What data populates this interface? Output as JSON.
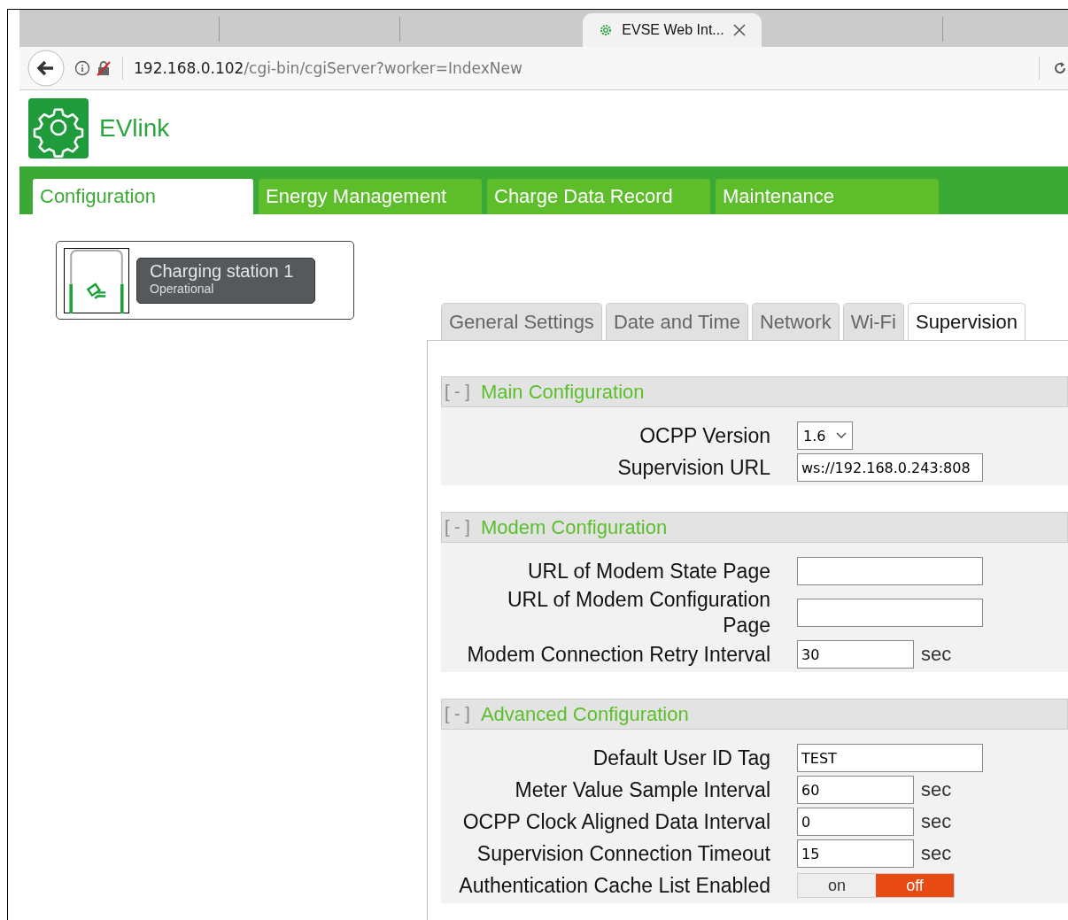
{
  "browser": {
    "tabs": [
      {
        "label": "EVSE Web Int...",
        "selected": true
      }
    ],
    "url_host": "192.168.0.102",
    "url_path": "/cgi-bin/cgiServer?worker=IndexNew"
  },
  "app": {
    "name": "EVlink"
  },
  "nav_tabs": [
    {
      "label": "Configuration",
      "selected": true
    },
    {
      "label": "Energy Management",
      "selected": false
    },
    {
      "label": "Charge Data Record",
      "selected": false
    },
    {
      "label": "Maintenance",
      "selected": false
    }
  ],
  "station": {
    "name": "Charging station 1",
    "status": "Operational"
  },
  "settings_tabs": [
    {
      "label": "General Settings",
      "selected": false
    },
    {
      "label": "Date and Time",
      "selected": false
    },
    {
      "label": "Network",
      "selected": false
    },
    {
      "label": "Wi-Fi",
      "selected": false
    },
    {
      "label": "Supervision",
      "selected": true
    }
  ],
  "sections": [
    {
      "toggle": "[ - ]",
      "title": "Main Configuration",
      "fields": [
        {
          "kind": "select",
          "label": "OCPP Version",
          "value": "1.6"
        },
        {
          "kind": "text",
          "label": "Supervision URL",
          "value": "ws://192.168.0.243:808"
        }
      ]
    },
    {
      "toggle": "[ - ]",
      "title": "Modem Configuration",
      "fields": [
        {
          "kind": "text",
          "label": "URL of Modem State Page"
        },
        {
          "kind": "text",
          "label": "URL of Modem Configuration Page"
        },
        {
          "kind": "text",
          "label": "Modem Connection Retry Interval",
          "value": "30",
          "unit": "sec"
        }
      ]
    },
    {
      "toggle": "[ - ]",
      "title": "Advanced Configuration",
      "fields": [
        {
          "kind": "text",
          "label": "Default User ID Tag",
          "value": "TEST"
        },
        {
          "kind": "text",
          "label": "Meter Value Sample Interval",
          "value": "60",
          "unit": "sec"
        },
        {
          "kind": "text",
          "label": "OCPP Clock Aligned Data Interval",
          "value": "0",
          "unit": "sec"
        },
        {
          "kind": "text",
          "label": "Supervision Connection Timeout",
          "value": "15",
          "unit": "sec"
        },
        {
          "kind": "toggle",
          "label": "Authentication Cache List Enabled",
          "on_label": "on",
          "off_label": "off",
          "on": false
        }
      ]
    }
  ]
}
